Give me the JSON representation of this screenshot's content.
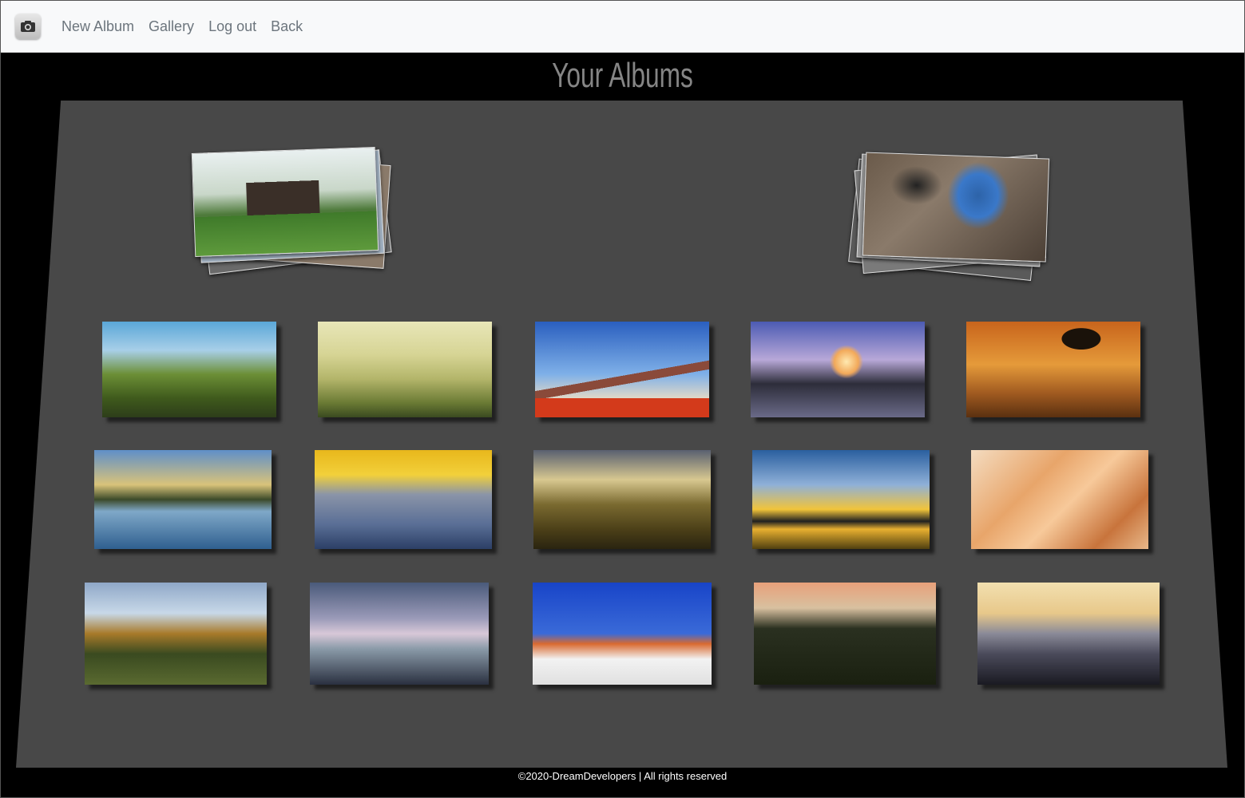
{
  "navbar": {
    "brand_icon": "camera-icon",
    "links": [
      "New Album",
      "Gallery",
      "Log out",
      "Back"
    ]
  },
  "page": {
    "title": "Your Albums"
  },
  "albums": [
    {
      "cover": "japanese-house-photo"
    },
    {
      "cover": "cassowary-photo"
    }
  ],
  "photos": [
    "coastal-mountains-photo",
    "misty-hills-photo",
    "mount-fuji-photo",
    "sea-stacks-sunset-photo",
    "savanna-tree-photo",
    "mountain-lake-reflection-photo",
    "sea-of-clouds-photo",
    "highland-valley-photo",
    "golden-sky-lake-photo",
    "sandstone-waves-photo",
    "autumn-lake-photo",
    "spring-forest-lake-photo",
    "desert-dead-tree-photo",
    "eucalyptus-sunset-photo",
    "mountain-silhouette-photo"
  ],
  "footer": {
    "text": "©2020-DreamDevelopers | All rights reserved"
  }
}
